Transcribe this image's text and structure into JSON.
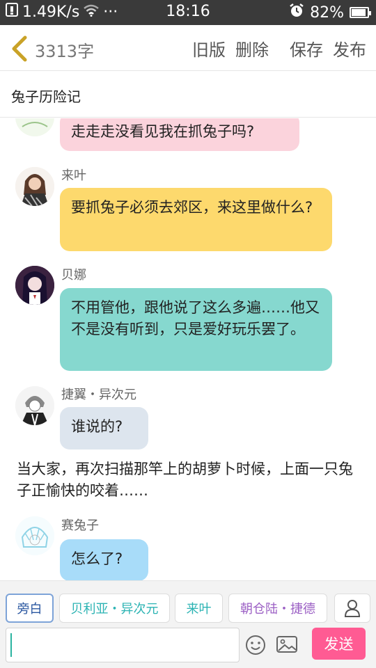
{
  "status_bar": {
    "network_speed": "1.49K/s",
    "dots": "···",
    "time": "18:16",
    "battery": "82%",
    "battery_level": 0.82
  },
  "header": {
    "word_count": "3313字",
    "actions": [
      "旧版",
      "删除",
      "保存",
      "发布"
    ]
  },
  "story": {
    "title": "兔子历险记"
  },
  "chat": {
    "messages": [
      {
        "name": "",
        "text": "走走走没看见我在抓兔子吗?",
        "bubble_color": "#fbd3dc"
      },
      {
        "name": "来叶",
        "text": "要抓兔子必须去郊区，来这里做什么?",
        "bubble_color": "#fdd96d"
      },
      {
        "name": "贝娜",
        "text": "不用管他，跟他说了这么多遍……他又不是没有听到，只是爱好玩乐罢了。",
        "bubble_color": "#86d8cf"
      },
      {
        "name": "捷翼・异次元",
        "text": "谁说的?",
        "bubble_color": "#dde5ee"
      },
      {
        "name": "赛兔子",
        "text": "怎么了?",
        "bubble_color": "#a8dcf9"
      }
    ],
    "narration": "当大家，再次扫描那竿上的胡萝卜时候，上面一只兔子正愉快的咬着……"
  },
  "character_bar": {
    "chips": [
      "旁白",
      "贝利亚・异次元",
      "来叶",
      "朝仓陆・捷德"
    ]
  },
  "input": {
    "value": "",
    "send_label": "发送"
  },
  "colors": {
    "accent_pink": "#ff5b93",
    "status_bar": "#3a3a3a",
    "back_arrow": "#c9a227"
  }
}
